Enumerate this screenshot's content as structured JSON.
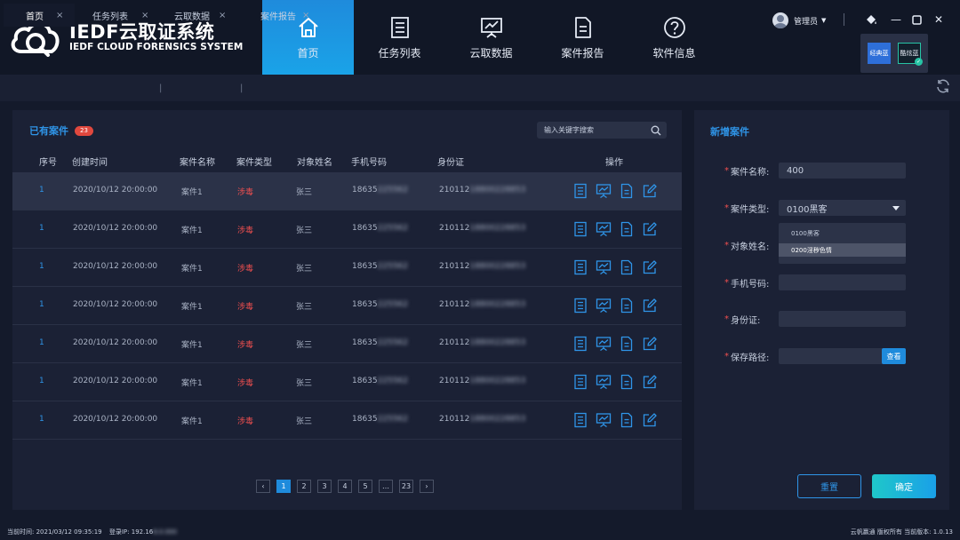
{
  "app": {
    "title_cn": "IEDF云取证系统",
    "title_en": "IEDF CLOUD FORENSICS SYSTEM"
  },
  "nav": [
    {
      "label": "首页",
      "icon": "home-icon"
    },
    {
      "label": "任务列表",
      "icon": "list-icon"
    },
    {
      "label": "云取数据",
      "icon": "chart-board-icon"
    },
    {
      "label": "案件报告",
      "icon": "document-icon"
    },
    {
      "label": "软件信息",
      "icon": "help-icon"
    }
  ],
  "user": {
    "name": "管理员"
  },
  "theme": {
    "classic_label": "经典蓝",
    "dark_label": "酷炫蓝",
    "classic_color": "#2e6fd9",
    "dark_accent": "#27c4a5"
  },
  "tabs": [
    {
      "label": "首页",
      "close": "×"
    },
    {
      "label": "任务列表",
      "close": "×"
    },
    {
      "label": "云取数据",
      "close": "×"
    },
    {
      "label": "案件报告",
      "close": "×"
    }
  ],
  "tab_separator": "|",
  "cases": {
    "title": "已有案件",
    "count": "23",
    "search_placeholder": "输入关键字搜索",
    "columns": [
      "序号",
      "创建时间",
      "案件名称",
      "案件类型",
      "对象姓名",
      "手机号码",
      "身份证",
      "操作"
    ],
    "rows": [
      {
        "idx": "1",
        "time": "2020/10/12 20:00:00",
        "name": "案件1",
        "type": "涉毒",
        "person": "张三",
        "phone_prefix": "18635",
        "phone_rest": "225562",
        "id_prefix": "210112",
        "id_rest": "18800228853"
      },
      {
        "idx": "1",
        "time": "2020/10/12 20:00:00",
        "name": "案件1",
        "type": "涉毒",
        "person": "张三",
        "phone_prefix": "18635",
        "phone_rest": "225562",
        "id_prefix": "210112",
        "id_rest": "18800228853"
      },
      {
        "idx": "1",
        "time": "2020/10/12 20:00:00",
        "name": "案件1",
        "type": "涉毒",
        "person": "张三",
        "phone_prefix": "18635",
        "phone_rest": "225562",
        "id_prefix": "210112",
        "id_rest": "18800228853"
      },
      {
        "idx": "1",
        "time": "2020/10/12 20:00:00",
        "name": "案件1",
        "type": "涉毒",
        "person": "张三",
        "phone_prefix": "18635",
        "phone_rest": "225562",
        "id_prefix": "210112",
        "id_rest": "18800228853"
      },
      {
        "idx": "1",
        "time": "2020/10/12 20:00:00",
        "name": "案件1",
        "type": "涉毒",
        "person": "张三",
        "phone_prefix": "18635",
        "phone_rest": "225562",
        "id_prefix": "210112",
        "id_rest": "18800228853"
      },
      {
        "idx": "1",
        "time": "2020/10/12 20:00:00",
        "name": "案件1",
        "type": "涉毒",
        "person": "张三",
        "phone_prefix": "18635",
        "phone_rest": "225562",
        "id_prefix": "210112",
        "id_rest": "18800228853"
      },
      {
        "idx": "1",
        "time": "2020/10/12 20:00:00",
        "name": "案件1",
        "type": "涉毒",
        "person": "张三",
        "phone_prefix": "18635",
        "phone_rest": "225562",
        "id_prefix": "210112",
        "id_rest": "18800228853"
      }
    ],
    "row_actions": [
      "list-icon",
      "chart-board-icon",
      "document-icon",
      "edit-icon"
    ],
    "pagination": {
      "prev": "‹",
      "pages": [
        "1",
        "2",
        "3",
        "4",
        "5",
        "…",
        "23"
      ],
      "next": "›",
      "current": "1"
    }
  },
  "new_case": {
    "title": "新增案件",
    "required_mark": "*",
    "fields": {
      "name": {
        "label": "案件名称:",
        "value": "400"
      },
      "type": {
        "label": "案件类型:",
        "value": "0100黑客"
      },
      "person": {
        "label": "对象姓名:",
        "value": ""
      },
      "phone": {
        "label": "手机号码:",
        "value": ""
      },
      "idcard": {
        "label": "身份证:",
        "value": ""
      },
      "path": {
        "label": "保存路径:",
        "value": ""
      }
    },
    "type_options": [
      "0100黑客",
      "0200淫秽色情"
    ],
    "view_button": "查看",
    "reset_button": "重置",
    "ok_button": "确定"
  },
  "footer": {
    "time_label": "当前时间:",
    "time_value": "2021/03/12 09:35:19",
    "ip_label": "登录IP:",
    "ip_prefix": "192.16",
    "ip_rest": "8.0.000",
    "right_text": "云帆赢通 版权所有 当前版本:",
    "version": "1.0.13"
  },
  "colors": {
    "accent": "#1f8bdc",
    "danger": "#f04f4f",
    "panel": "#1b2135",
    "background": "#141a2b"
  }
}
